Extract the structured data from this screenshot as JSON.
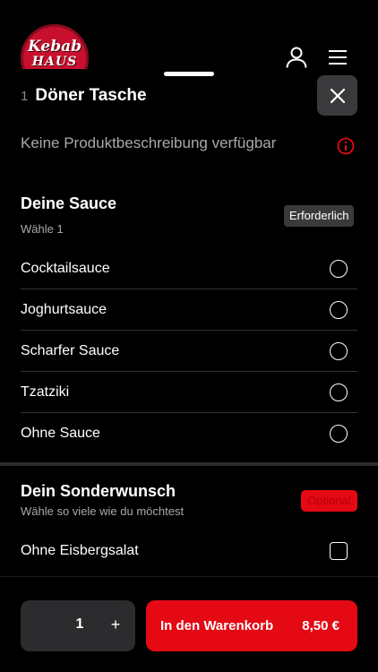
{
  "logo": {
    "line1": "Kebab",
    "line2": "HAUS"
  },
  "header": {
    "icons": [
      "user-icon",
      "menu-icon"
    ]
  },
  "product": {
    "quantity_prefix": "1",
    "title": "Döner Tasche",
    "description": "Keine Produktbeschreibung verfügbar"
  },
  "groups": [
    {
      "title": "Deine Sauce",
      "subtitle": "Wähle 1",
      "badge": "Erforderlich",
      "selection": "radio",
      "options": [
        "Cocktailsauce",
        "Joghurtsauce",
        "Scharfer Sauce",
        "Tzatziki",
        "Ohne Sauce"
      ]
    },
    {
      "title": "Dein Sonderwunsch",
      "subtitle": "Wähle so viele wie du möchtest",
      "badge": "Optional",
      "selection": "checkbox",
      "options": [
        "Ohne Eisbergsalat"
      ]
    }
  ],
  "footer": {
    "quantity": "1",
    "plus": "+",
    "add_label": "In den Warenkorb",
    "price": "8,50 €"
  },
  "colors": {
    "accent": "#e50914",
    "background": "#000000",
    "surface": "#2c2c2e"
  }
}
